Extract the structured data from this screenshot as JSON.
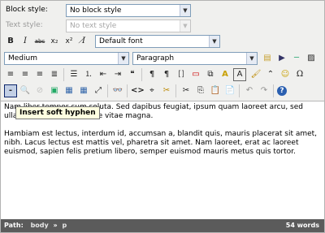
{
  "labels": {
    "block_style": "Block style:",
    "text_style": "Text style:"
  },
  "selects": {
    "block_style": "No block style",
    "text_style": "No text style",
    "font": "Default font",
    "size": "Medium",
    "format": "Paragraph"
  },
  "glyphs": {
    "bold": "B",
    "italic": "I",
    "strike": "abc",
    "subscript": "x₂",
    "superscript": "x²",
    "clear": "I̸",
    "justify_left": "≡",
    "justify_center": "≡",
    "justify_right": "≡",
    "justify_full": "≣",
    "bullets": "☰",
    "numbers": "⒈",
    "outdent": "⇤",
    "indent": "⇥",
    "quote": "❝",
    "ltr": "¶",
    "rtl": "¶",
    "abbr": "A",
    "acronym": "[]",
    "attribs": "▭",
    "pagebreak": "⧉",
    "table": "▦",
    "link": "🔗",
    "unlink": "⊘",
    "anchor": "⚓",
    "image": "▣",
    "media": "▶",
    "special": "Ω",
    "emoticon": "☺",
    "nonbreak": "⍽",
    "forecolor": "A",
    "backcolor": "A",
    "paint": "🖌",
    "hr": "─",
    "template": "▤",
    "softhyphen": "-",
    "search": "🔍",
    "replace": "⇄",
    "picture": "▨",
    "tablegrid": "▦",
    "fullscreen": "⤢",
    "find": "👓",
    "code": "<>",
    "visualaid": "⌖",
    "cleanup": "✂",
    "cut": "✂",
    "copy": "⎘",
    "paste": "📋",
    "pastetext": "📄",
    "undo": "↶",
    "redo": "↷",
    "help": "?"
  },
  "tooltip": "Insert soft hyphen",
  "content": {
    "p1": "Nam liber tempor cum soluta. Sed dapibus feugiat, ipsum quam laoreet arcu, sed ullamcorper augue congue vitae magna.",
    "p2": "Hambiam est lectus, interdum id, accumsan a, blandit quis, mauris placerat sit amet, nibh. Lacus lectus est mattis vel, pharetra sit amet. Nam laoreet, erat ac laoreet euismod, sapien felis pretium libero, semper euismod mauris metus quis tortor."
  },
  "status": {
    "path_label": "Path:",
    "path_body": "body",
    "path_sep": "»",
    "path_p": "p",
    "words": "54 words"
  }
}
